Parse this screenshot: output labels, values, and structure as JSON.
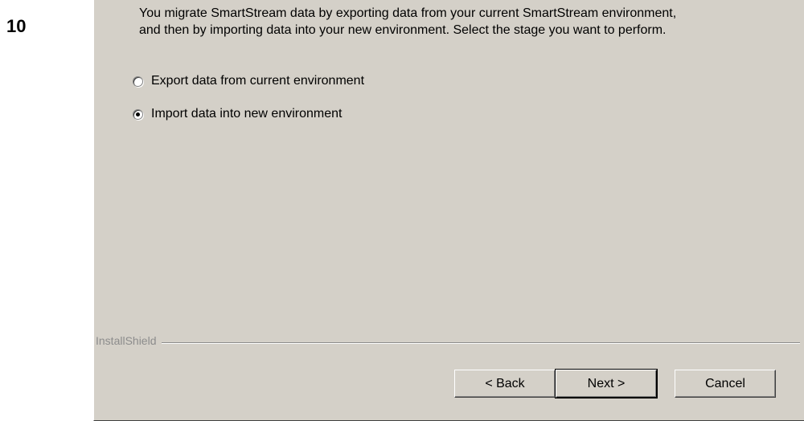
{
  "step_number": "10",
  "description_line1": "You migrate SmartStream data by exporting data from your current SmartStream environment,",
  "description_line2": "and then by importing data into your new environment.  Select the stage you want to perform.",
  "options": [
    {
      "label": "Export data from current environment",
      "selected": false
    },
    {
      "label": "Import data into new environment",
      "selected": true
    }
  ],
  "branding": "InstallShield",
  "buttons": {
    "back": "< Back",
    "next": "Next >",
    "cancel": "Cancel"
  }
}
